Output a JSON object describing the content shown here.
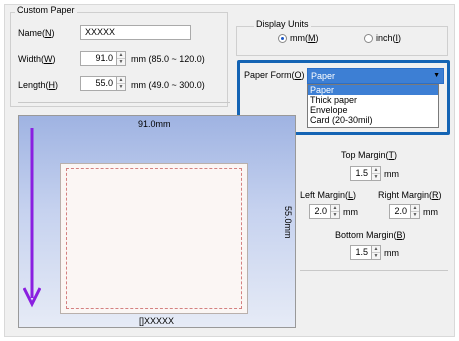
{
  "custom_paper": {
    "legend": "Custom Paper",
    "name_label": "Name(",
    "name_key": "N",
    "name_close": ")",
    "name_value": "XXXXX",
    "width_label": "Width(",
    "width_key": "W",
    "width_close": ")",
    "width_value": "91.0",
    "width_range": "mm (85.0 ~ 120.0)",
    "length_label": "Length(",
    "length_key": "H",
    "length_close": ")",
    "length_value": "55.0",
    "length_range": "mm (49.0 ~ 300.0)"
  },
  "display_units": {
    "legend": "Display Units",
    "mm_label": "mm(",
    "mm_key": "M",
    "mm_close": ")",
    "inch_label": "inch(",
    "inch_key": "I",
    "inch_close": ")",
    "selected": "mm"
  },
  "paper_form": {
    "label": "Paper Form(",
    "key": "O",
    "close": ")",
    "value": "Paper",
    "options": [
      "Paper",
      "Thick paper",
      "Envelope",
      "Card (20-30mil)"
    ],
    "selected_index": 0
  },
  "preview": {
    "width_text": "91.0mm",
    "height_text": "55.0mm",
    "name_text": "[]XXXXX"
  },
  "margins": {
    "top_label": "Top Margin(",
    "top_key": "T",
    "top_close": ")",
    "top_value": "1.5",
    "left_label": "Left Margin(",
    "left_key": "L",
    "left_close": ")",
    "left_value": "2.0",
    "right_label": "Right Margin(",
    "right_key": "R",
    "right_close": ")",
    "right_value": "2.0",
    "bottom_label": "Bottom Margin(",
    "bottom_key": "B",
    "bottom_close": ")",
    "bottom_value": "1.5",
    "unit": "mm"
  },
  "colors": {
    "highlight": "#1464b4",
    "arrow": "#8a1fe0",
    "selection": "#3d7fd4"
  }
}
